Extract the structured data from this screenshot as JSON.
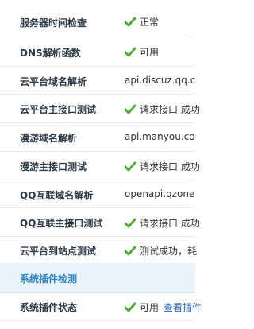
{
  "rows": [
    {
      "label": "服务器时间检查",
      "value": "正常",
      "check": true
    },
    {
      "label": "DNS解析函数",
      "value": "可用",
      "check": true
    },
    {
      "label": "云平台域名解析",
      "value": "api.discuz.qq.c",
      "check": false
    },
    {
      "label": "云平台主接口测试",
      "value": "请求接口 成功",
      "check": true
    },
    {
      "label": "漫游域名解析",
      "value": "api.manyou.co",
      "check": false
    },
    {
      "label": "漫游主接口测试",
      "value": "请求接口 成功",
      "check": true
    },
    {
      "label": "QQ互联域名解析",
      "value": "openapi.qzone",
      "check": false
    },
    {
      "label": "QQ互联主接口测试",
      "value": "请求接口 成功",
      "check": true
    },
    {
      "label": "云平台到站点测试",
      "value": "测试成功，耗",
      "check": true
    }
  ],
  "section": {
    "title": "系统插件检测"
  },
  "plugin_row": {
    "label": "系统插件状态",
    "value": "可用",
    "link": "查看插件"
  },
  "colors": {
    "check_green": "#4caf2f",
    "section_blue": "#2a84c6",
    "link_blue": "#2a66b5"
  }
}
